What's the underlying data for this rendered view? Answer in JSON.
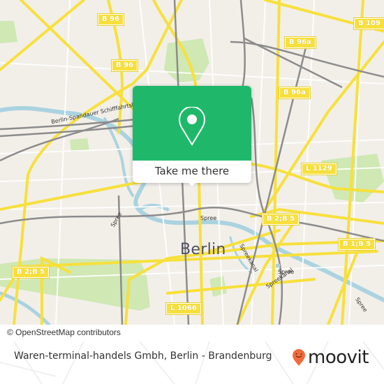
{
  "map": {
    "city_label": "Berlin",
    "attribution": "© OpenStreetMap contributors",
    "colors": {
      "land": "#f2efe9",
      "park": "#c8e6a8",
      "water": "#aad3df",
      "major_road": "#f7e03c",
      "rail": "#8c8c8c",
      "minor_road": "#ffffff"
    },
    "road_labels": [
      {
        "id": "b96-top",
        "text": "B 96"
      },
      {
        "id": "b96-mid",
        "text": "B 96"
      },
      {
        "id": "b109",
        "text": "B 109"
      },
      {
        "id": "b96a-top",
        "text": "B 96a"
      },
      {
        "id": "b96a-mid",
        "text": "B 96a"
      },
      {
        "id": "l1129",
        "text": "L 1129"
      },
      {
        "id": "b2b5-east",
        "text": "B 2;B 5"
      },
      {
        "id": "b1b5",
        "text": "B 1;B 5"
      },
      {
        "id": "b2b5-west",
        "text": "B 2;B 5"
      },
      {
        "id": "l1066",
        "text": "L 1066"
      }
    ],
    "water_labels": [
      {
        "id": "spandauer-kanal",
        "text": "Berlin-Spandauer Schifffahrtskanal"
      },
      {
        "id": "spree-center",
        "text": "Spree"
      },
      {
        "id": "spree-west",
        "text": "Spree"
      },
      {
        "id": "spreekanal-1",
        "text": "Spreekanal"
      },
      {
        "id": "spreekanal-2",
        "text": "Spreekanal"
      },
      {
        "id": "spree-mid",
        "text": "Spree"
      },
      {
        "id": "spree-east",
        "text": "Spree"
      }
    ]
  },
  "popup": {
    "icon": "map-pin-icon",
    "button_label": "Take me there",
    "accent_color": "#1fb86a"
  },
  "footer": {
    "title": "Waren-terminal-handels Gmbh, Berlin - Brandenburg",
    "brand": "moovit",
    "brand_icon": "moovit-smiley-pin-icon",
    "brand_color": "#f26b3a"
  }
}
